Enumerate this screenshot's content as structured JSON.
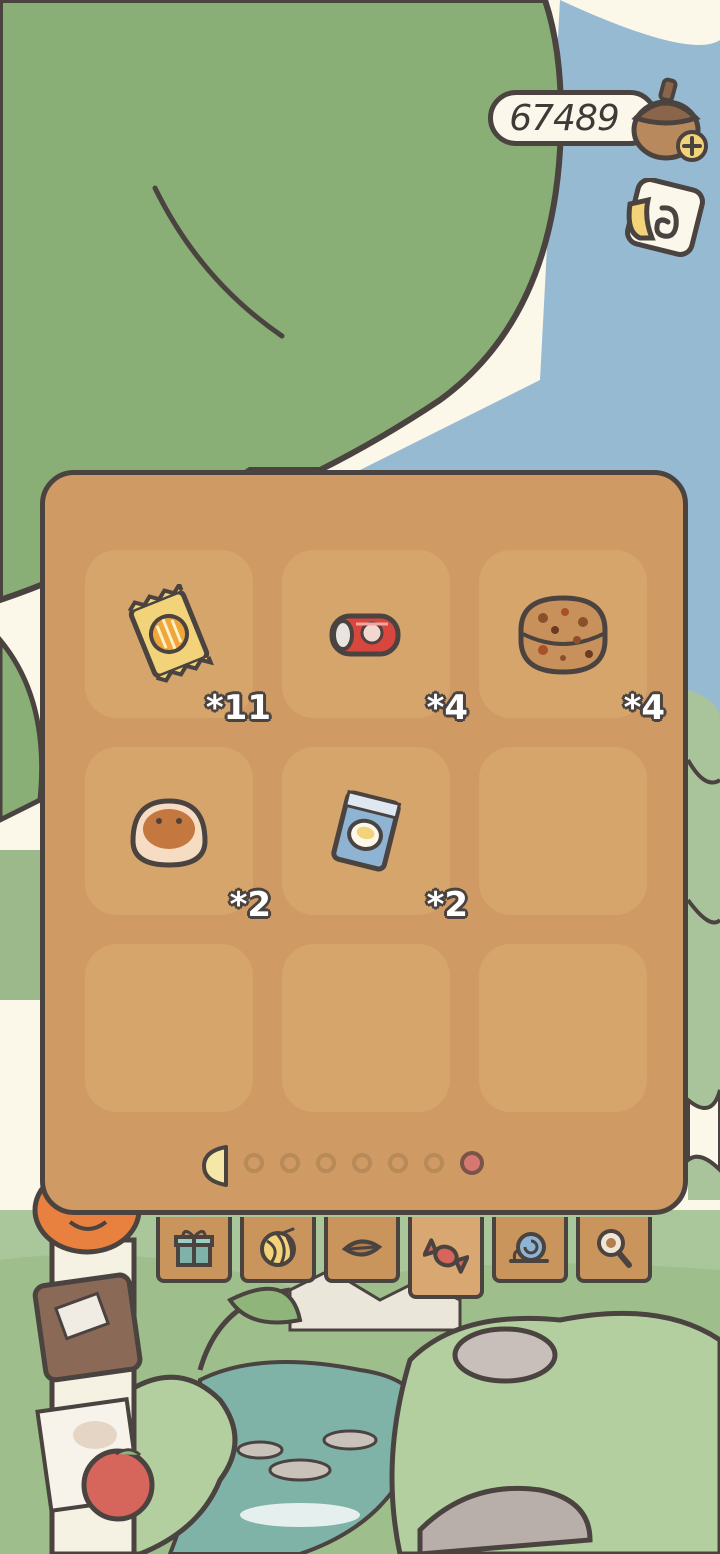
{
  "currency": {
    "amount": "67489",
    "icon": "acorn-icon"
  },
  "inventory": {
    "slots": [
      {
        "item": "snack-bag",
        "count": "*11"
      },
      {
        "item": "soda-can",
        "count": "*4"
      },
      {
        "item": "cookie",
        "count": "*4"
      },
      {
        "item": "bun",
        "count": "*2"
      },
      {
        "item": "canned-food",
        "count": "*2"
      },
      {
        "item": "",
        "count": ""
      },
      {
        "item": "",
        "count": ""
      },
      {
        "item": "",
        "count": ""
      },
      {
        "item": "",
        "count": ""
      }
    ],
    "pages": {
      "total": 7,
      "current": 7
    }
  },
  "tabs": [
    {
      "name": "gift",
      "icon": "gift-icon"
    },
    {
      "name": "yarn",
      "icon": "yarn-ball-icon"
    },
    {
      "name": "leaf",
      "icon": "leaf-icon"
    },
    {
      "name": "candy",
      "icon": "candy-icon",
      "active": true
    },
    {
      "name": "snail",
      "icon": "snail-icon"
    },
    {
      "name": "magnifier",
      "icon": "magnifier-icon"
    }
  ]
}
